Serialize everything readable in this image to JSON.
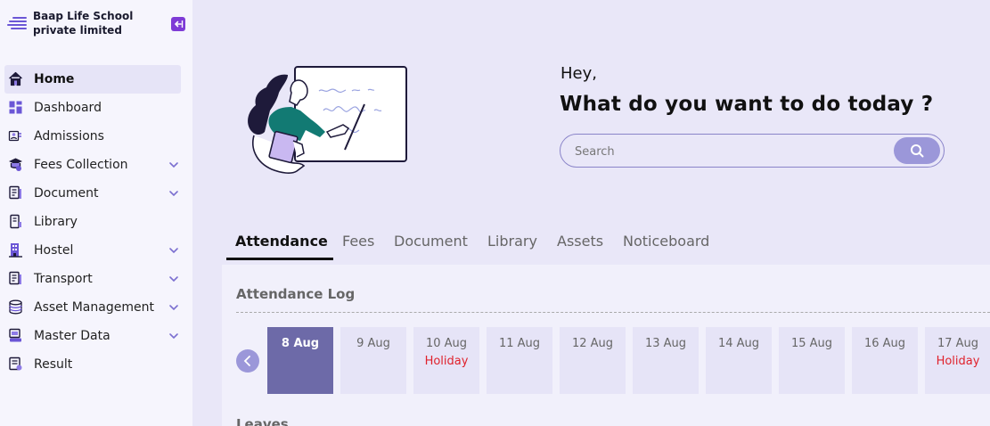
{
  "brand": {
    "name": "Baap Life School private limited",
    "menu_icon": "hamburger-icon",
    "collapse_icon": "arrow-left-icon"
  },
  "nav": [
    {
      "label": "Home",
      "icon": "home-icon",
      "active": true,
      "expandable": false
    },
    {
      "label": "Dashboard",
      "icon": "dashboard-icon",
      "active": false,
      "expandable": false
    },
    {
      "label": "Admissions",
      "icon": "admissions-icon",
      "active": false,
      "expandable": false
    },
    {
      "label": "Fees Collection",
      "icon": "fees-icon",
      "active": false,
      "expandable": true
    },
    {
      "label": "Document",
      "icon": "document-icon",
      "active": false,
      "expandable": true
    },
    {
      "label": "Library",
      "icon": "library-icon",
      "active": false,
      "expandable": false
    },
    {
      "label": "Hostel",
      "icon": "hostel-icon",
      "active": false,
      "expandable": true
    },
    {
      "label": "Transport",
      "icon": "transport-icon",
      "active": false,
      "expandable": true
    },
    {
      "label": "Asset Management",
      "icon": "database-icon",
      "active": false,
      "expandable": true
    },
    {
      "label": "Master Data",
      "icon": "master-data-icon",
      "active": false,
      "expandable": true
    },
    {
      "label": "Result",
      "icon": "result-icon",
      "active": false,
      "expandable": false
    }
  ],
  "hero": {
    "greeting": "Hey,",
    "headline": "What do you want to do today ?",
    "search_placeholder": "Search"
  },
  "tabs": [
    {
      "label": "Attendance",
      "active": true
    },
    {
      "label": "Fees",
      "active": false
    },
    {
      "label": "Document",
      "active": false
    },
    {
      "label": "Library",
      "active": false
    },
    {
      "label": "Assets",
      "active": false
    },
    {
      "label": "Noticeboard",
      "active": false
    }
  ],
  "attendance": {
    "title": "Attendance Log",
    "days": [
      {
        "date": "8 Aug",
        "note": "",
        "selected": true
      },
      {
        "date": "9 Aug",
        "note": "",
        "selected": false
      },
      {
        "date": "10 Aug",
        "note": "Holiday",
        "selected": false
      },
      {
        "date": "11 Aug",
        "note": "",
        "selected": false
      },
      {
        "date": "12 Aug",
        "note": "",
        "selected": false
      },
      {
        "date": "13 Aug",
        "note": "",
        "selected": false
      },
      {
        "date": "14 Aug",
        "note": "",
        "selected": false
      },
      {
        "date": "15 Aug",
        "note": "",
        "selected": false
      },
      {
        "date": "16 Aug",
        "note": "",
        "selected": false
      },
      {
        "date": "17 Aug",
        "note": "Holiday",
        "selected": false
      }
    ]
  },
  "leaves": {
    "title": "Leaves"
  },
  "colors": {
    "accent": "#6b56d6",
    "selected_day": "#6d6aa8",
    "holiday": "#e0222c",
    "background": "#e9e7f8"
  }
}
